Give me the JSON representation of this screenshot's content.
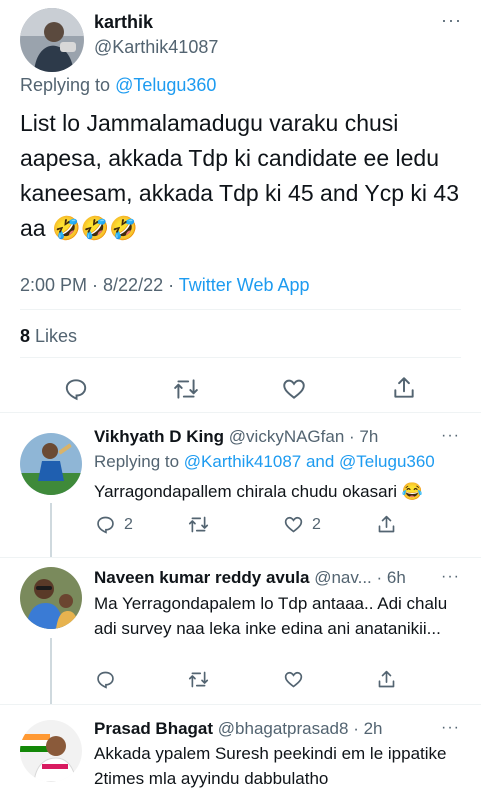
{
  "main_tweet": {
    "name": "karthik",
    "handle": "@Karthik41087",
    "replying_prefix": "Replying to",
    "replying_to": "@Telugu360",
    "text": "List lo Jammalamadugu varaku chusi aapesa, akkada Tdp ki candidate ee ledu kaneesam, akkada Tdp ki 45 and Ycp ki 43 aa",
    "emoji": "🤣🤣🤣",
    "time": "2:00 PM · 8/22/22 · ",
    "app": "Twitter Web App",
    "likes_count": "8",
    "likes_label": "Likes"
  },
  "replies": [
    {
      "name": "Vikhyath D King",
      "handle": "@vickyNAGfan",
      "time": "· 7h",
      "replying_prefix": "Replying to",
      "replying_to": "@Karthik41087 and @Telugu360",
      "text": "Yarragondapallem chirala chudu okasari",
      "emoji": "😂",
      "reply_count": "2",
      "like_count": "2"
    },
    {
      "name": "Naveen kumar reddy avula",
      "handle": "@nav...",
      "time": "· 6h",
      "text": "Ma Yerragondapalem lo Tdp antaaa..  Adi chalu adi survey naa leka inke edina ani anatanikii...",
      "reply_count": "",
      "like_count": ""
    },
    {
      "name": "Prasad Bhagat",
      "handle": "@bhagatprasad8",
      "time": "· 2h",
      "text": "Akkada ypalem Suresh peekindi em le ippatike 2times mla ayyindu dabbulatho"
    }
  ],
  "colors": {
    "accent": "#1d9bf0",
    "secondary_text": "#536471",
    "primary_text": "#0f1419"
  },
  "icons": [
    "more-icon",
    "reply-icon",
    "retweet-icon",
    "like-icon",
    "share-icon"
  ]
}
